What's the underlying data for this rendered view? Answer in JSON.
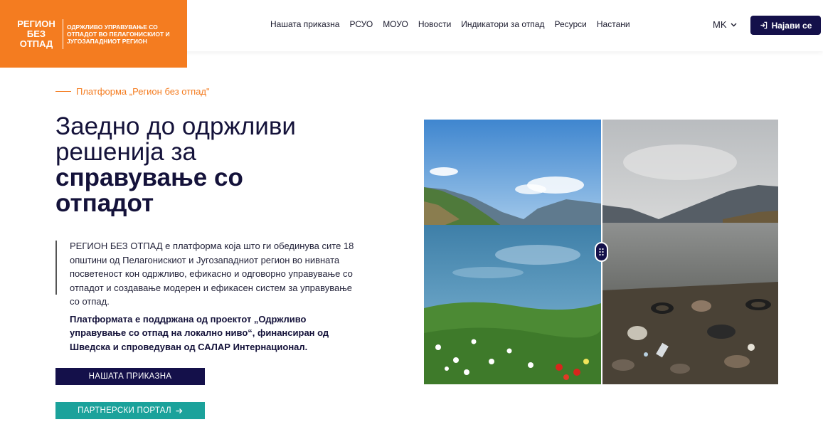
{
  "brand": {
    "logo_line1": "РЕГИОН",
    "logo_line2": "БЕЗ",
    "logo_line3": "ОТПАД",
    "logo_sub": "ОДРЖЛИВО УПРАВУВАЊЕ СО ОТПАДОТ ВО ПЕЛАГОНИСКИОТ И ЈУГОЗАПАДНИОТ РЕГИОН",
    "color": "#f47c20"
  },
  "nav": {
    "items": [
      {
        "label": "Нашата приказна"
      },
      {
        "label": "РСУО"
      },
      {
        "label": "МОУО"
      },
      {
        "label": "Новости"
      },
      {
        "label": "Индикатори за отпад"
      },
      {
        "label": "Ресурси"
      },
      {
        "label": "Настани"
      }
    ],
    "language": "MK",
    "login_label": "Најави се"
  },
  "hero": {
    "eyebrow": "Платформа „Регион без отпад\"",
    "title_light_1": "Заедно до одржливи",
    "title_light_2": "решенија за",
    "title_bold_1": "справување со",
    "title_bold_2": "отпадот",
    "description": "РЕГИОН БЕЗ ОТПАД е платформа која што ги обединува сите 18 општини од Пелагонискиот и Југозападниот регион во нивната посветеност кон одржливо, ефикасно и одговорно управување со отпадот и создавање модерен и ефикасен систем за управување со отпад.",
    "support": "Платформата е поддржана од проектот „Одржливо управување со отпад на локално ниво“, финансиран од Шведска и спроведуван од САЛАР Интернационал.",
    "btn_story": "НАШАТА ПРИКАЗНА",
    "btn_portal": "ПАРТНЕРСКИ ПОРТАЛ",
    "btn_portal_icon": "arrow-right-icon"
  },
  "colors": {
    "navy": "#14104a",
    "teal": "#1ba29b",
    "orange": "#f47c20"
  }
}
